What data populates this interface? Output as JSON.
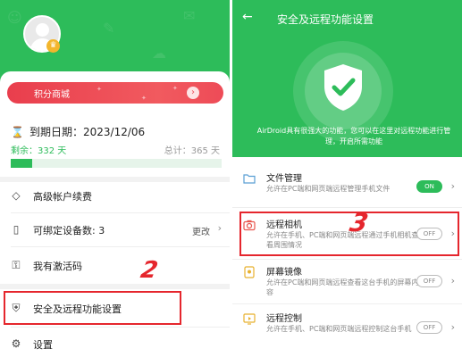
{
  "left": {
    "mall": {
      "label": "积分商城",
      "arrow_icon": "arrow-right-icon"
    },
    "expire": {
      "label": "到期日期：2023/12/06"
    },
    "remain_text": "剩余：332 天",
    "total_text": "总计：365 天",
    "progress_fraction": 0.1,
    "menu": [
      {
        "key": "renew",
        "label": "高级帐户续费",
        "icon": "diamond-icon"
      },
      {
        "key": "devices",
        "label": "可绑定设备数: 3",
        "extra": "更改",
        "icon": "phone-icon"
      },
      {
        "key": "activation",
        "label": "我有激活码",
        "icon": "key-icon"
      },
      {
        "key": "security",
        "label": "安全及远程功能设置",
        "icon": "shield-icon"
      },
      {
        "key": "settings",
        "label": "设置",
        "icon": "gear-icon"
      }
    ],
    "step_marker": "2"
  },
  "right": {
    "title": "安全及远程功能设置",
    "description": "AirDroid具有很强大的功能，您可以在这里对远程功能进行管理，开启所需功能",
    "features": [
      {
        "key": "files",
        "title": "文件管理",
        "desc": "允许在PC端和网页端远程管理手机文件",
        "toggle": "ON",
        "icon": "folder-icon"
      },
      {
        "key": "camera",
        "title": "远程相机",
        "desc": "允许在手机、PC端和网页端远程通过手机相机查看周围情况",
        "toggle": "OFF",
        "icon": "camera-icon"
      },
      {
        "key": "mirror",
        "title": "屏幕镜像",
        "desc": "允许在PC端和网页端远程查看这台手机的屏幕内容",
        "toggle": "OFF",
        "icon": "screen-mirror-icon"
      },
      {
        "key": "control",
        "title": "远程控制",
        "desc": "允许在手机、PC端和网页端远程控制这台手机",
        "toggle": "OFF",
        "icon": "remote-control-icon"
      }
    ],
    "step_marker": "3"
  },
  "colors": {
    "brand_green": "#2dbc5a",
    "highlight_red": "#e5262d",
    "mall_red": "#ee4b57"
  }
}
